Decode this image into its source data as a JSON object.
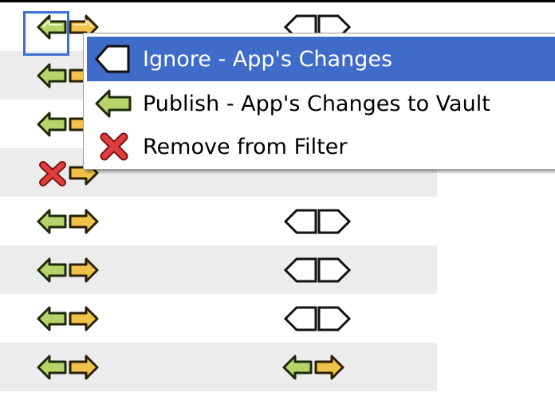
{
  "colors": {
    "selection": "#3f6cc9",
    "row_alt": "#ececec",
    "focus": "#3d6fd1",
    "arrow_green": "#b8d36a",
    "arrow_orange": "#f0c24a",
    "remove_red": "#e23d3d"
  },
  "rows": [
    {
      "left_icon": "publish-arrow-icon",
      "right_icon": "app-arrow-icon",
      "status_icon": "ignore-outline-icon"
    },
    {
      "left_icon": "publish-arrow-icon",
      "right_icon": "app-arrow-icon",
      "status_icon": ""
    },
    {
      "left_icon": "publish-arrow-icon",
      "right_icon": "app-arrow-icon",
      "status_icon": ""
    },
    {
      "left_icon": "remove-x-icon",
      "right_icon": "app-arrow-icon",
      "status_icon": ""
    },
    {
      "left_icon": "publish-arrow-icon",
      "right_icon": "app-arrow-icon",
      "status_icon": "ignore-outline-icon"
    },
    {
      "left_icon": "publish-arrow-icon",
      "right_icon": "app-arrow-icon",
      "status_icon": "ignore-outline-icon"
    },
    {
      "left_icon": "publish-arrow-icon",
      "right_icon": "app-arrow-icon",
      "status_icon": "ignore-outline-icon"
    },
    {
      "left_icon": "publish-arrow-icon",
      "right_icon": "app-arrow-icon",
      "status_icon": "publish-arrow-icon"
    }
  ],
  "context_menu": {
    "items": [
      {
        "label": "Ignore - App's Changes",
        "icon": "ignore-outline-icon",
        "selected": true
      },
      {
        "label": "Publish - App's Changes to Vault",
        "icon": "publish-arrow-icon",
        "selected": false
      },
      {
        "label": "Remove from Filter",
        "icon": "remove-x-icon",
        "selected": false
      }
    ]
  }
}
